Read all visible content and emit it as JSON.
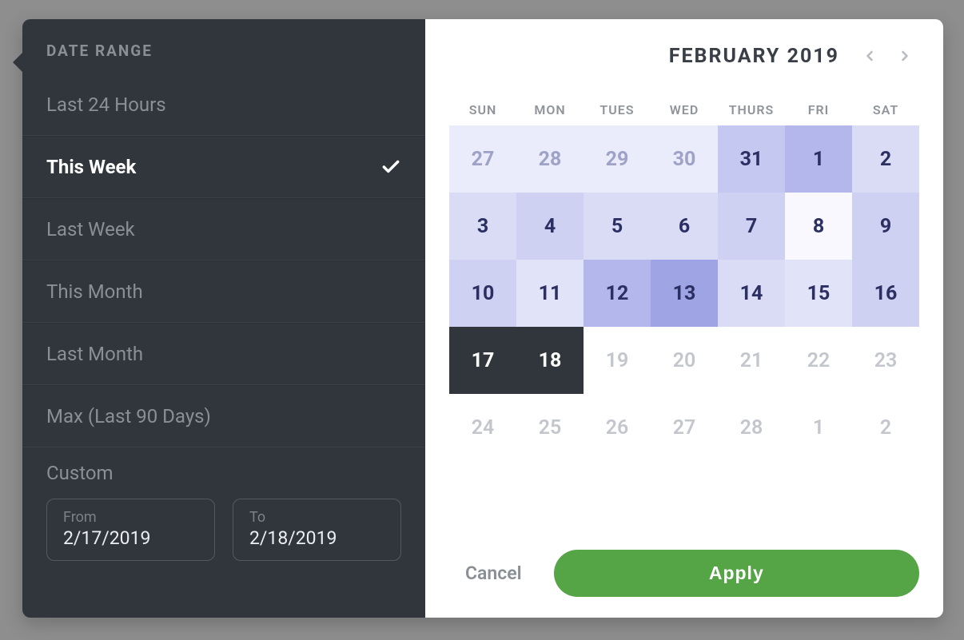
{
  "sidebar": {
    "title": "DATE RANGE",
    "presets": [
      {
        "label": "Last 24 Hours",
        "selected": false
      },
      {
        "label": "This Week",
        "selected": true
      },
      {
        "label": "Last Week",
        "selected": false
      },
      {
        "label": "This Month",
        "selected": false
      },
      {
        "label": "Last Month",
        "selected": false
      },
      {
        "label": "Max (Last 90 Days)",
        "selected": false
      }
    ],
    "custom": {
      "label": "Custom",
      "from_label": "From",
      "from_value": "2/17/2019",
      "to_label": "To",
      "to_value": "2/18/2019"
    }
  },
  "calendar": {
    "month_label": "FEBRUARY 2019",
    "dow": [
      "SUN",
      "MON",
      "TUES",
      "WED",
      "THURS",
      "FRI",
      "SAT"
    ],
    "weeks": [
      [
        {
          "d": "27",
          "cls": "shade-past"
        },
        {
          "d": "28",
          "cls": "shade-past"
        },
        {
          "d": "29",
          "cls": "shade-past"
        },
        {
          "d": "30",
          "cls": "shade-past"
        },
        {
          "d": "31",
          "cls": "shade-4"
        },
        {
          "d": "1",
          "cls": "shade-5"
        },
        {
          "d": "2",
          "cls": "shade-2"
        }
      ],
      [
        {
          "d": "3",
          "cls": "shade-2"
        },
        {
          "d": "4",
          "cls": "shade-3"
        },
        {
          "d": "5",
          "cls": "shade-2"
        },
        {
          "d": "6",
          "cls": "shade-2"
        },
        {
          "d": "7",
          "cls": "shade-3"
        },
        {
          "d": "8",
          "cls": "shade-light"
        },
        {
          "d": "9",
          "cls": "shade-3"
        }
      ],
      [
        {
          "d": "10",
          "cls": "shade-3"
        },
        {
          "d": "11",
          "cls": "shade-1"
        },
        {
          "d": "12",
          "cls": "shade-5"
        },
        {
          "d": "13",
          "cls": "shade-6"
        },
        {
          "d": "14",
          "cls": "shade-2"
        },
        {
          "d": "15",
          "cls": "shade-1"
        },
        {
          "d": "16",
          "cls": "shade-3"
        }
      ],
      [
        {
          "d": "17",
          "cls": "sel"
        },
        {
          "d": "18",
          "cls": "sel"
        },
        {
          "d": "19",
          "cls": "future"
        },
        {
          "d": "20",
          "cls": "future"
        },
        {
          "d": "21",
          "cls": "future"
        },
        {
          "d": "22",
          "cls": "future"
        },
        {
          "d": "23",
          "cls": "future"
        }
      ],
      [
        {
          "d": "24",
          "cls": "future"
        },
        {
          "d": "25",
          "cls": "future"
        },
        {
          "d": "26",
          "cls": "future"
        },
        {
          "d": "27",
          "cls": "future"
        },
        {
          "d": "28",
          "cls": "future"
        },
        {
          "d": "1",
          "cls": "future"
        },
        {
          "d": "2",
          "cls": "future"
        }
      ]
    ]
  },
  "actions": {
    "cancel": "Cancel",
    "apply": "Apply"
  }
}
